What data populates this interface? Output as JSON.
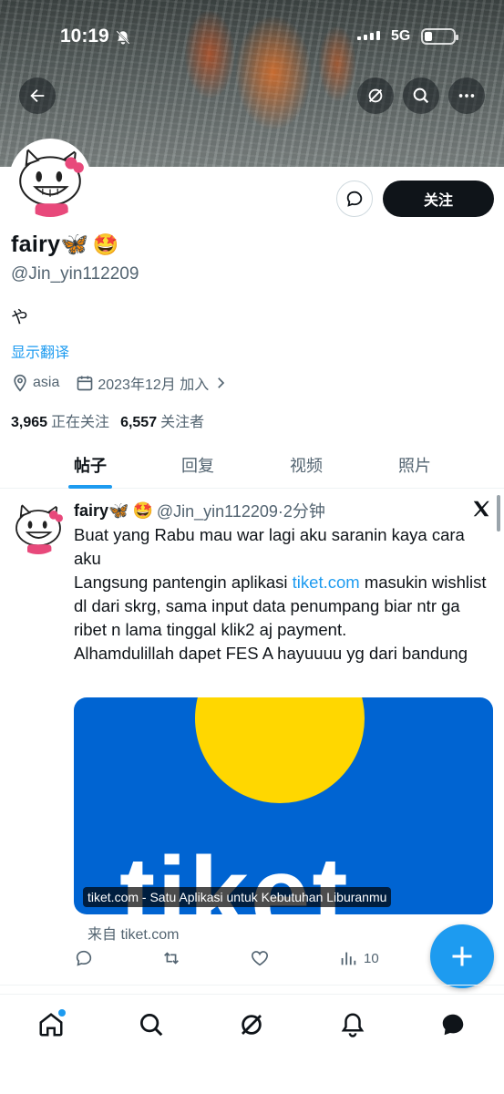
{
  "status_bar": {
    "time": "10:19",
    "network": "5G"
  },
  "profile": {
    "name": "fairy🦋",
    "name_emoji": "🤩",
    "handle": "@Jin_yin112209",
    "bio": "や",
    "translate_label": "显示翻译",
    "location": "asia",
    "joined": "2023年12月 加入",
    "following_count": "3,965",
    "following_label": "正在关注",
    "followers_count": "6,557",
    "followers_label": "关注者",
    "follow_button": "关注"
  },
  "tabs": [
    {
      "label": "帖子",
      "active": true
    },
    {
      "label": "回复"
    },
    {
      "label": "视频"
    },
    {
      "label": "照片"
    }
  ],
  "tweet": {
    "name": "fairy🦋",
    "name_emoji": "🤩",
    "handle_time": "@Jin_yin112209·2分钟",
    "line1": "Buat yang Rabu mau war lagi aku saranin kaya cara aku",
    "line2_pre": "Langsung pantengin aplikasi ",
    "link": "tiket.com",
    "line2_post": " masukin wishlist dl dari skrg, sama input data penumpang biar ntr ga ribet n lama tinggal klik2 aj payment.",
    "line3": "Alhamdulillah dapet FES A hayuuuu yg dari bandung",
    "card_brand": "tiket",
    "card_caption": "tiket.com - Satu Aplikasi untuk Kebutuhan Liburanmu",
    "from_label": "来自 tiket.com",
    "views": "10"
  },
  "colors": {
    "accent": "#1d9bf0",
    "card_bg": "#0064d2",
    "card_sun": "#ffd700"
  }
}
